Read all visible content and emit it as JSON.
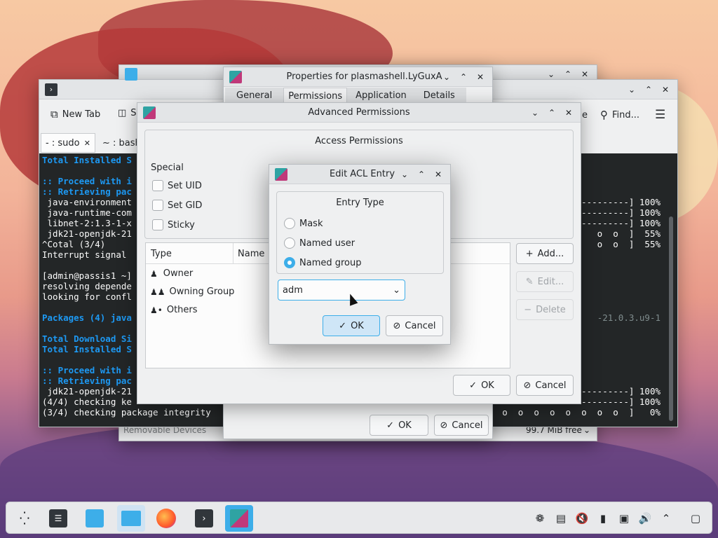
{
  "files_window": {
    "sidebar_item": "Removable Devices",
    "free_space": "99.7 MiB free"
  },
  "terminal": {
    "toolbar": {
      "new_tab": "New Tab",
      "find": "Find...",
      "split_fragment": "S",
      "find_prefix_fragment": "e"
    },
    "tabs": [
      {
        "label": "- : sudo"
      },
      {
        "label": "~ : bash"
      }
    ],
    "lines_left": [
      "Total Installed S",
      "",
      ":: Proceed with i",
      ":: Retrieving pac",
      " java-environment",
      " java-runtime-com",
      " libnet-2:1.3-1-x",
      " jdk21-openjdk-21",
      "^Cotal (3/4)",
      "Interrupt signal",
      "",
      "[admin@passis1 ~]",
      "resolving depende",
      "looking for confl",
      "",
      "Packages (4) java",
      "",
      "Total Download Si",
      "Total Installed S",
      "",
      ":: Proceed with i",
      ":: Retrieving pac",
      " jdk21-openjdk-21",
      "(4/4) checking ke",
      "(3/4) checking package integrity"
    ],
    "lines_right": [
      {
        "row": 4,
        "text": "---------] 100%"
      },
      {
        "row": 5,
        "text": "---------] 100%"
      },
      {
        "row": 6,
        "text": "---------] 100%"
      },
      {
        "row": 7,
        "text": " o  o  ]  55%"
      },
      {
        "row": 8,
        "text": " o  o  ]  55%"
      },
      {
        "row": 15,
        "text": "-21.0.3.u9-1"
      },
      {
        "row": 22,
        "text": "---------] 100%"
      },
      {
        "row": 23,
        "text": "---------] 100%"
      },
      {
        "row": 24,
        "text": "o  o  o  o  o  o  o  o  o  o  ]   0%"
      }
    ]
  },
  "properties_dialog": {
    "title": "Properties for plasmashell.LyGuxA",
    "tabs": [
      "General",
      "Permissions",
      "Application",
      "Details"
    ],
    "active_tab": "Permissions",
    "ok_label": "OK",
    "cancel_label": "Cancel"
  },
  "advanced_permissions": {
    "title": "Advanced Permissions",
    "section_title": "Access Permissions",
    "special_label": "Special",
    "special_options": [
      "Set UID",
      "Set GID",
      "Sticky"
    ],
    "columns": [
      "Type",
      "Name"
    ],
    "rows": [
      {
        "icon": "user-icon",
        "type": "Owner"
      },
      {
        "icon": "group-icon",
        "type": "Owning Group"
      },
      {
        "icon": "others-icon",
        "type": "Others"
      }
    ],
    "add_label": "Add...",
    "edit_label": "Edit...",
    "delete_label": "Delete",
    "ok_label": "OK",
    "cancel_label": "Cancel"
  },
  "edit_acl": {
    "title": "Edit ACL Entry",
    "group_title": "Entry Type",
    "options": [
      "Mask",
      "Named user",
      "Named group"
    ],
    "selected_option": "Named group",
    "combo_value": "adm",
    "ok_label": "OK",
    "cancel_label": "Cancel"
  },
  "taskbar": {
    "items": [
      "application-launcher-icon",
      "system-settings-icon",
      "discover-icon",
      "file-manager-icon",
      "firefox-icon",
      "konsole-icon",
      "properties-dialog-icon"
    ],
    "tray": [
      "network-config-icon",
      "clipboard-icon",
      "volume-muted-icon",
      "usb-icon",
      "network-icon",
      "volume-icon",
      "expand-tray-icon",
      "show-desktop-icon"
    ]
  },
  "colors": {
    "accent": "#3daee9",
    "terminal_bg": "#232627",
    "terminal_blue": "#1d99f3"
  }
}
